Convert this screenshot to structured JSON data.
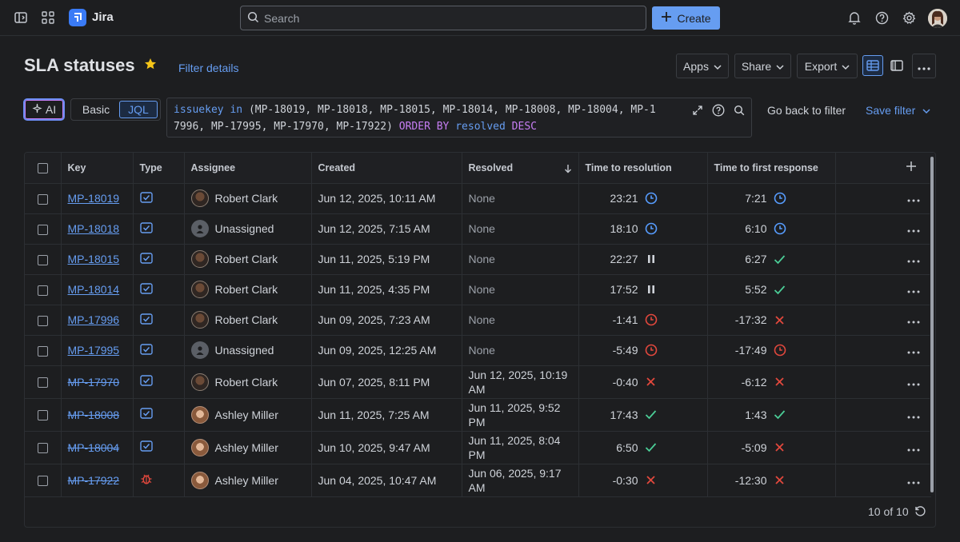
{
  "app": {
    "name": "Jira",
    "search_placeholder": "Search",
    "create_label": "Create"
  },
  "header": {
    "title": "SLA statuses",
    "filter_details": "Filter details",
    "apps_label": "Apps",
    "share_label": "Share",
    "export_label": "Export"
  },
  "query": {
    "ai_label": "AI",
    "basic_label": "Basic",
    "jql_label": "JQL",
    "kw_issuekey": "issuekey",
    "kw_in": "in",
    "keys_text": "(MP-18019, MP-18018, MP-18015, MP-18014, MP-18008, MP-18004, MP-17996, MP-17995, MP-17970, MP-17922)",
    "kw_order_by": "ORDER BY",
    "kw_resolved": "resolved",
    "kw_desc": "DESC",
    "go_back": "Go back to filter",
    "save_filter": "Save filter"
  },
  "table": {
    "columns": [
      "Key",
      "Type",
      "Assignee",
      "Created",
      "Resolved",
      "Time to resolution",
      "Time to first response"
    ],
    "rows": [
      {
        "key": "MP-18019",
        "resolved_issue": false,
        "type": "task",
        "assignee": "Robert Clark",
        "avatar": "robert",
        "created": "Jun 12, 2025, 10:11 AM",
        "resolved": "None",
        "ttr": "23:21",
        "ttr_icon": "clock-blue",
        "tfr": "7:21",
        "tfr_icon": "clock-blue"
      },
      {
        "key": "MP-18018",
        "resolved_issue": false,
        "type": "task",
        "assignee": "Unassigned",
        "avatar": "unassigned",
        "created": "Jun 12, 2025, 7:15 AM",
        "resolved": "None",
        "ttr": "18:10",
        "ttr_icon": "clock-blue",
        "tfr": "6:10",
        "tfr_icon": "clock-blue"
      },
      {
        "key": "MP-18015",
        "resolved_issue": false,
        "type": "task",
        "assignee": "Robert Clark",
        "avatar": "robert",
        "created": "Jun 11, 2025, 5:19 PM",
        "resolved": "None",
        "ttr": "22:27",
        "ttr_icon": "pause",
        "tfr": "6:27",
        "tfr_icon": "check"
      },
      {
        "key": "MP-18014",
        "resolved_issue": false,
        "type": "task",
        "assignee": "Robert Clark",
        "avatar": "robert",
        "created": "Jun 11, 2025, 4:35 PM",
        "resolved": "None",
        "ttr": "17:52",
        "ttr_icon": "pause",
        "tfr": "5:52",
        "tfr_icon": "check"
      },
      {
        "key": "MP-17996",
        "resolved_issue": false,
        "type": "task",
        "assignee": "Robert Clark",
        "avatar": "robert",
        "created": "Jun 09, 2025, 7:23 AM",
        "resolved": "None",
        "ttr": "-1:41",
        "ttr_icon": "clock-red",
        "tfr": "-17:32",
        "tfr_icon": "cross"
      },
      {
        "key": "MP-17995",
        "resolved_issue": false,
        "type": "task",
        "assignee": "Unassigned",
        "avatar": "unassigned",
        "created": "Jun 09, 2025, 12:25 AM",
        "resolved": "None",
        "ttr": "-5:49",
        "ttr_icon": "clock-red",
        "tfr": "-17:49",
        "tfr_icon": "clock-red"
      },
      {
        "key": "MP-17970",
        "resolved_issue": true,
        "type": "task",
        "assignee": "Robert Clark",
        "avatar": "robert",
        "created": "Jun 07, 2025, 8:11 PM",
        "resolved": "Jun 12, 2025, 10:19 AM",
        "ttr": "-0:40",
        "ttr_icon": "cross",
        "tfr": "-6:12",
        "tfr_icon": "cross"
      },
      {
        "key": "MP-18008",
        "resolved_issue": true,
        "type": "task",
        "assignee": "Ashley Miller",
        "avatar": "ashley",
        "created": "Jun 11, 2025, 7:25 AM",
        "resolved": "Jun 11, 2025, 9:52 PM",
        "ttr": "17:43",
        "ttr_icon": "check",
        "tfr": "1:43",
        "tfr_icon": "check"
      },
      {
        "key": "MP-18004",
        "resolved_issue": true,
        "type": "task",
        "assignee": "Ashley Miller",
        "avatar": "ashley",
        "created": "Jun 10, 2025, 9:47 AM",
        "resolved": "Jun 11, 2025, 8:04 PM",
        "ttr": "6:50",
        "ttr_icon": "check",
        "tfr": "-5:09",
        "tfr_icon": "cross"
      },
      {
        "key": "MP-17922",
        "resolved_issue": true,
        "type": "bug",
        "assignee": "Ashley Miller",
        "avatar": "ashley",
        "created": "Jun 04, 2025, 10:47 AM",
        "resolved": "Jun 06, 2025, 9:17 AM",
        "ttr": "-0:30",
        "ttr_icon": "cross",
        "tfr": "-12:30",
        "tfr_icon": "cross"
      }
    ],
    "footer_count": "10 of 10"
  },
  "colors": {
    "accent": "#669df1",
    "danger": "#e2483d",
    "success": "#4bce97",
    "clock_blue": "#579dff",
    "bg": "#1d1e20"
  }
}
